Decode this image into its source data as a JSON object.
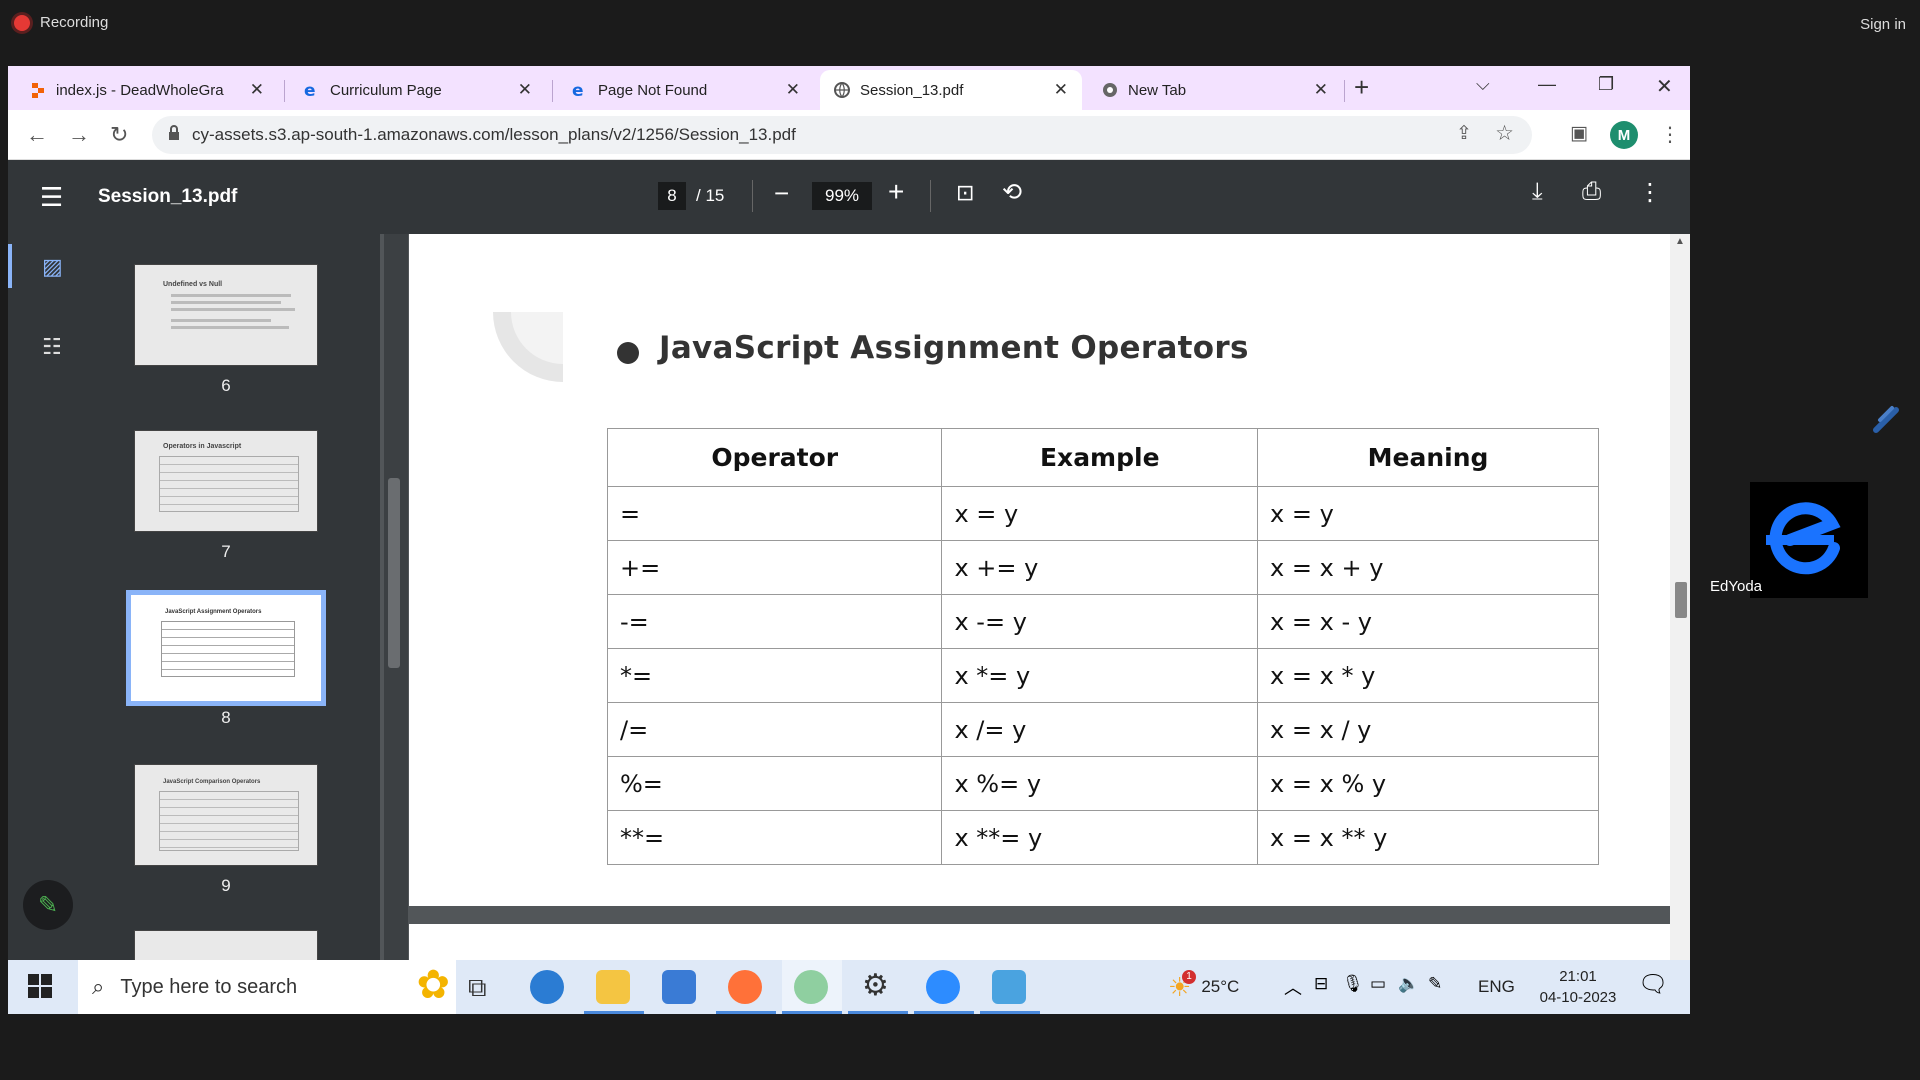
{
  "recording": {
    "label": "Recording"
  },
  "signin": {
    "label": "Sign in"
  },
  "tabs": [
    {
      "label": "index.js - DeadWholeGra",
      "icon": "replit-icon"
    },
    {
      "label": "Curriculum Page",
      "icon": "edge-icon"
    },
    {
      "label": "Page Not Found",
      "icon": "edge-icon"
    },
    {
      "label": "Session_13.pdf",
      "icon": "globe-icon",
      "active": true
    },
    {
      "label": "New Tab",
      "icon": "chrome-icon"
    }
  ],
  "url": "cy-assets.s3.ap-south-1.amazonaws.com/lesson_plans/v2/1256/Session_13.pdf",
  "profile_initial": "M",
  "pdf": {
    "filename": "Session_13.pdf",
    "current_page": "8",
    "total_pages": "/ 15",
    "zoom": "99%"
  },
  "thumbnails": [
    {
      "num": "6",
      "title": "Undefined vs Null"
    },
    {
      "num": "7",
      "title": "Operators in Javascript"
    },
    {
      "num": "8",
      "title": "JavaScript Assignment Operators",
      "selected": true
    },
    {
      "num": "9",
      "title": "JavaScript Comparison Operators"
    }
  ],
  "page": {
    "title": "JavaScript Assignment Operators",
    "headers": [
      "Operator",
      "Example",
      "Meaning"
    ],
    "rows": [
      [
        "=",
        "x = y",
        "x = y"
      ],
      [
        "+=",
        "x += y",
        "x = x + y"
      ],
      [
        "-=",
        "x -= y",
        "x = x - y"
      ],
      [
        "*=",
        "x *= y",
        "x = x * y"
      ],
      [
        "/=",
        "x /= y",
        "x = x / y"
      ],
      [
        "%=",
        "x %= y",
        "x = x % y"
      ],
      [
        "**=",
        "x **= y",
        "x = x ** y"
      ]
    ]
  },
  "taskbar": {
    "search_placeholder": "Type here to search",
    "weather": "25°C",
    "lang": "ENG",
    "time": "21:01",
    "date": "04-10-2023",
    "weather_badge": "1"
  },
  "overlay": {
    "name": "EdYoda"
  }
}
